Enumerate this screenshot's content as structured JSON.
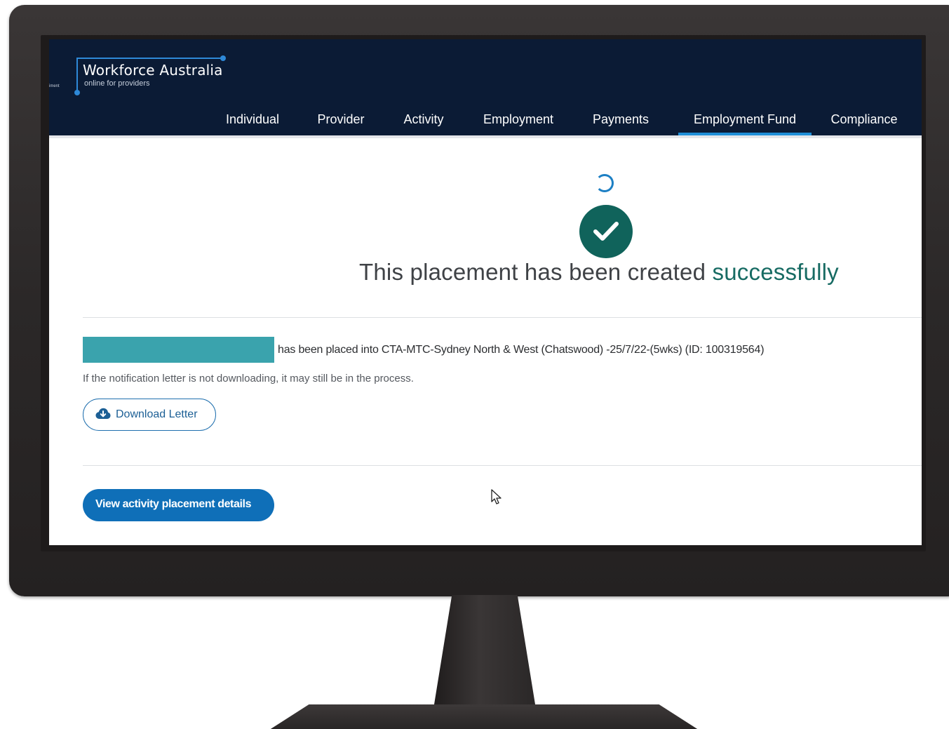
{
  "header": {
    "gov_fragment": "iment",
    "logo_title": "Workforce Australia",
    "logo_subtitle": "online for providers"
  },
  "nav": {
    "items": [
      {
        "label": "Individual",
        "active": false
      },
      {
        "label": "Provider",
        "active": false
      },
      {
        "label": "Activity",
        "active": false
      },
      {
        "label": "Employment",
        "active": false
      },
      {
        "label": "Payments",
        "active": false
      },
      {
        "label": "Employment Fund",
        "active": true
      },
      {
        "label": "Compliance",
        "active": false
      }
    ]
  },
  "status": {
    "icon": "check-circle-icon",
    "loading_icon": "spinner-icon",
    "headline_prefix": "This placement has been created",
    "headline_accent": "successfully"
  },
  "placement": {
    "message": "has been placed into CTA-MTC-Sydney North & West (Chatswood) -25/7/22-(5wks) (ID: 100319564)",
    "note": "If the notification letter is not downloading, it may still be in the process."
  },
  "actions": {
    "download_label": "Download Letter",
    "download_icon": "cloud-download-icon",
    "view_details_label": "View activity placement details"
  },
  "colors": {
    "header_bg": "#0b1b35",
    "accent_blue": "#1f8fd8",
    "success_green": "#10635b",
    "redaction_teal": "#3aa3ad",
    "primary_button": "#0f6fb8"
  }
}
